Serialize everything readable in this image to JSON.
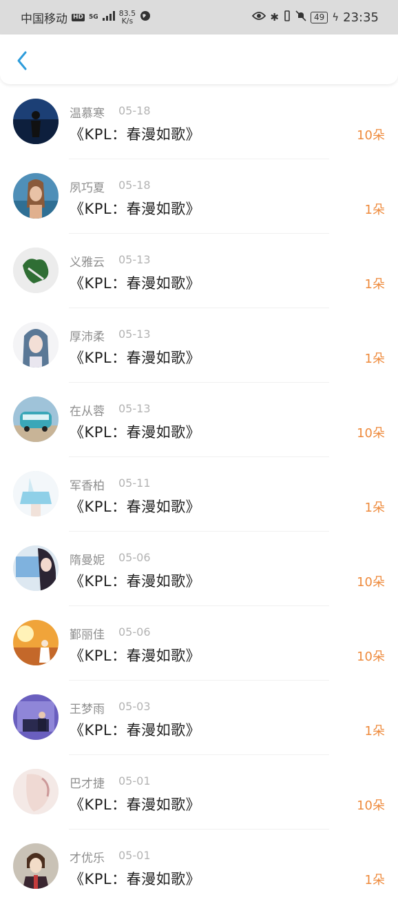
{
  "status_bar": {
    "carrier": "中国移动",
    "hd": "HD",
    "network": "5G",
    "speed_value": "83.5",
    "speed_unit": "K/s",
    "battery": "49",
    "time": "23:35"
  },
  "colors": {
    "accent": "#2d9cdb",
    "amount": "#ee8a3c"
  },
  "header": {
    "back_icon": "chevron-left-icon"
  },
  "items": [
    {
      "name": "温慕寒",
      "date": "05-18",
      "title": "《KPL：春漫如歌》",
      "amount": "10朵"
    },
    {
      "name": "夙巧夏",
      "date": "05-18",
      "title": "《KPL：春漫如歌》",
      "amount": "1朵"
    },
    {
      "name": "义雅云",
      "date": "05-13",
      "title": "《KPL：春漫如歌》",
      "amount": "1朵"
    },
    {
      "name": "厚沛柔",
      "date": "05-13",
      "title": "《KPL：春漫如歌》",
      "amount": "1朵"
    },
    {
      "name": "在从蓉",
      "date": "05-13",
      "title": "《KPL：春漫如歌》",
      "amount": "10朵"
    },
    {
      "name": "军香柏",
      "date": "05-11",
      "title": "《KPL：春漫如歌》",
      "amount": "1朵"
    },
    {
      "name": "隋曼妮",
      "date": "05-06",
      "title": "《KPL：春漫如歌》",
      "amount": "10朵"
    },
    {
      "name": "鄞丽佳",
      "date": "05-06",
      "title": "《KPL：春漫如歌》",
      "amount": "10朵"
    },
    {
      "name": "王梦雨",
      "date": "05-03",
      "title": "《KPL：春漫如歌》",
      "amount": "1朵"
    },
    {
      "name": "巴才捷",
      "date": "05-01",
      "title": "《KPL：春漫如歌》",
      "amount": "10朵"
    },
    {
      "name": "才优乐",
      "date": "05-01",
      "title": "《KPL：春漫如歌》",
      "amount": "1朵"
    }
  ]
}
